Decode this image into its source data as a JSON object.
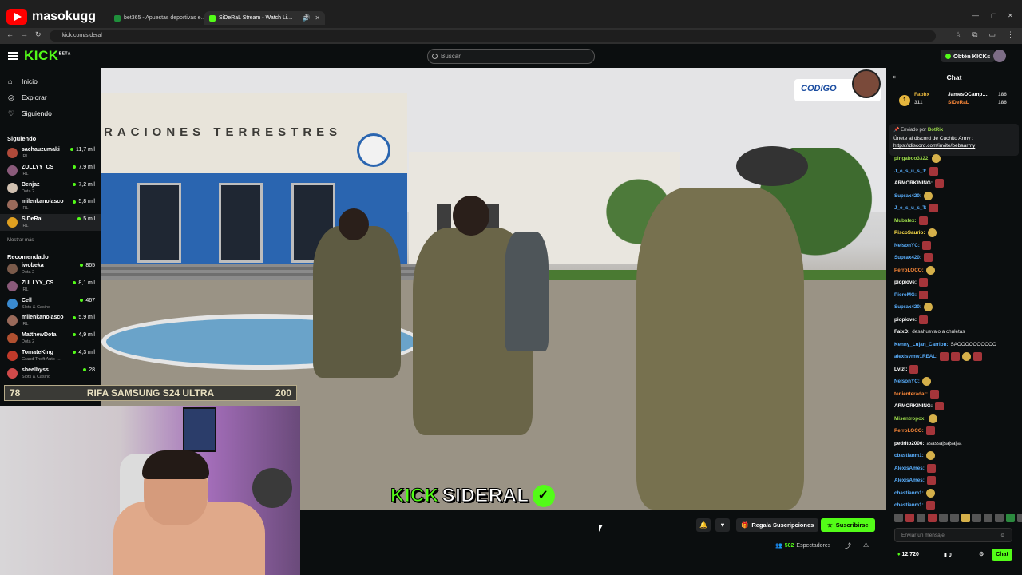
{
  "overlay": {
    "channel_name": "masokugg",
    "raffle": {
      "left": "78",
      "title": "RIFA SAMSUNG S24 ULTRA",
      "right": "200"
    },
    "stream_brand_kick": "KICK",
    "stream_brand_name": "SIDERAL",
    "sponsor_label": "CODIGO"
  },
  "browser": {
    "tabs": [
      {
        "label": "bet365 - Apuestas deportivas e…"
      },
      {
        "label": "SiDeRaL Stream - Watch Li…"
      }
    ],
    "url": "kick.com/sideral"
  },
  "kick": {
    "logo": "KICK",
    "logo_sup": "BETA",
    "search_placeholder": "Buscar",
    "get_kicks": "Obtén KICKs"
  },
  "sidebar": {
    "nav": [
      {
        "label": "Inicio",
        "icon": "home-icon"
      },
      {
        "label": "Explorar",
        "icon": "compass-icon"
      },
      {
        "label": "Siguiendo",
        "icon": "heart-icon"
      }
    ],
    "following_title": "Siguiendo",
    "following": [
      {
        "name": "sachauzumaki",
        "category": "IRL",
        "viewers": "11,7 mil",
        "color": "#b04a3a"
      },
      {
        "name": "ZULLYY_CS",
        "category": "IRL",
        "viewers": "7,9 mil",
        "color": "#8a5a7a"
      },
      {
        "name": "Benjaz",
        "category": "Dota 2",
        "viewers": "7,2 mil",
        "color": "#d0c0b0"
      },
      {
        "name": "milenkanolasco",
        "category": "IRL",
        "viewers": "5,8 mil",
        "color": "#9a6a5a"
      },
      {
        "name": "SiDeRaL",
        "category": "IRL",
        "viewers": "5 mil",
        "color": "#e0a020"
      }
    ],
    "show_more": "Mostrar más",
    "recommended_title": "Recomendado",
    "recommended": [
      {
        "name": "iwobeka",
        "category": "Dota 2",
        "viewers": "865",
        "color": "#7a5a4a"
      },
      {
        "name": "ZULLYY_CS",
        "category": "IRL",
        "viewers": "8,1 mil",
        "color": "#8a5a7a"
      },
      {
        "name": "Cell",
        "category": "Slots & Casino",
        "viewers": "467",
        "color": "#3a8ad0"
      },
      {
        "name": "milenkanolasco",
        "category": "IRL",
        "viewers": "5,9 mil",
        "color": "#9a6a5a"
      },
      {
        "name": "MatthewDota",
        "category": "Dota 2",
        "viewers": "4,9 mil",
        "color": "#b05030"
      },
      {
        "name": "TomateKing",
        "category": "Grand Theft Auto …",
        "viewers": "4,3 mil",
        "color": "#c03a2a"
      },
      {
        "name": "sheelbyss",
        "category": "Slots & Casino",
        "viewers": "28",
        "color": "#d04a4a"
      }
    ]
  },
  "player": {
    "gift_label": "Regala Suscripciones",
    "subscribe_label": "Suscribirse",
    "viewers_count": "502",
    "viewers_label": "Espectadores"
  },
  "chat": {
    "title": "Chat",
    "leaders": [
      {
        "name": "Fabbx",
        "amount": "311"
      },
      {
        "name": "JamesOCamp…",
        "amount": "186"
      },
      {
        "name": "SiDeRaL",
        "amount": "186"
      }
    ],
    "pinned": {
      "sent_by_label": "Enviado por",
      "sender": "BotRix",
      "text": "Únete al discord de Cuchito Army :",
      "link": "https://discord.com/invite/bebaarmy"
    },
    "messages": [
      {
        "user": "pingaboo3322:",
        "color": "#9bd94a",
        "text": "",
        "emotes": 1
      },
      {
        "user": "J_e_s_u_s_T:",
        "color": "#5ab0ff",
        "text": "",
        "emotes": 1
      },
      {
        "user": "ARMORKINING:",
        "color": "#ffffff",
        "text": "",
        "emotes": 1
      },
      {
        "user": "Suprax420:",
        "color": "#5ab0ff",
        "text": "",
        "emotes": 1
      },
      {
        "user": "J_e_s_u_s_T:",
        "color": "#5ab0ff",
        "text": "",
        "emotes": 1
      },
      {
        "user": "Mubafex:",
        "color": "#9bd94a",
        "text": "",
        "emotes": 1
      },
      {
        "user": "PiscoSaurio:",
        "color": "#ffe04a",
        "text": "",
        "emotes": 1
      },
      {
        "user": "NelsonYC:",
        "color": "#5ab0ff",
        "text": "",
        "emotes": 1
      },
      {
        "user": "Suprax420:",
        "color": "#5ab0ff",
        "text": "",
        "emotes": 1
      },
      {
        "user": "PerroLOCO:",
        "color": "#ff8a3a",
        "text": "",
        "emotes": 1
      },
      {
        "user": "piopiove:",
        "color": "#ffffff",
        "text": "",
        "emotes": 1
      },
      {
        "user": "PieroMG:",
        "color": "#5ab0ff",
        "text": "",
        "emotes": 1
      },
      {
        "user": "Suprax420:",
        "color": "#5ab0ff",
        "text": "",
        "emotes": 1
      },
      {
        "user": "piopiove:",
        "color": "#ffffff",
        "text": "",
        "emotes": 1
      },
      {
        "user": "FalxD:",
        "color": "#ffffff",
        "text": "desahuevalo a chuletas",
        "emotes": 0
      },
      {
        "user": "Kenny_Lujan_Carrion:",
        "color": "#5ab0ff",
        "text": "SAOOOOOOOOOO",
        "emotes": 0
      },
      {
        "user": "alexisvmw1REAL:",
        "color": "#5ab0ff",
        "text": "",
        "emotes": 4
      },
      {
        "user": "Lvizt:",
        "color": "#ffffff",
        "text": "",
        "emotes": 1
      },
      {
        "user": "NelsonYC:",
        "color": "#5ab0ff",
        "text": "",
        "emotes": 1
      },
      {
        "user": "tenienteradar:",
        "color": "#ff8a3a",
        "text": "",
        "emotes": 1
      },
      {
        "user": "ARMORKINING:",
        "color": "#ffffff",
        "text": "",
        "emotes": 1
      },
      {
        "user": "Misentropox:",
        "color": "#9bd94a",
        "text": "",
        "emotes": 1
      },
      {
        "user": "PerroLOCO:",
        "color": "#ff8a3a",
        "text": "",
        "emotes": 1
      },
      {
        "user": "pedrito2006:",
        "color": "#ffffff",
        "text": "asassajsajsajsa",
        "emotes": 0
      },
      {
        "user": "cbastianm1:",
        "color": "#5ab0ff",
        "text": "",
        "emotes": 1
      },
      {
        "user": "AlexisAmes:",
        "color": "#5ab0ff",
        "text": "",
        "emotes": 1
      },
      {
        "user": "AlexisAmes:",
        "color": "#5ab0ff",
        "text": "",
        "emotes": 1
      },
      {
        "user": "cbastianm1:",
        "color": "#5ab0ff",
        "text": "",
        "emotes": 1
      },
      {
        "user": "cbastianm1:",
        "color": "#5ab0ff",
        "text": "",
        "emotes": 1
      }
    ],
    "input_placeholder": "Enviar un mensaje",
    "points": "12.720",
    "other_count": "0",
    "send_label": "Chat"
  }
}
